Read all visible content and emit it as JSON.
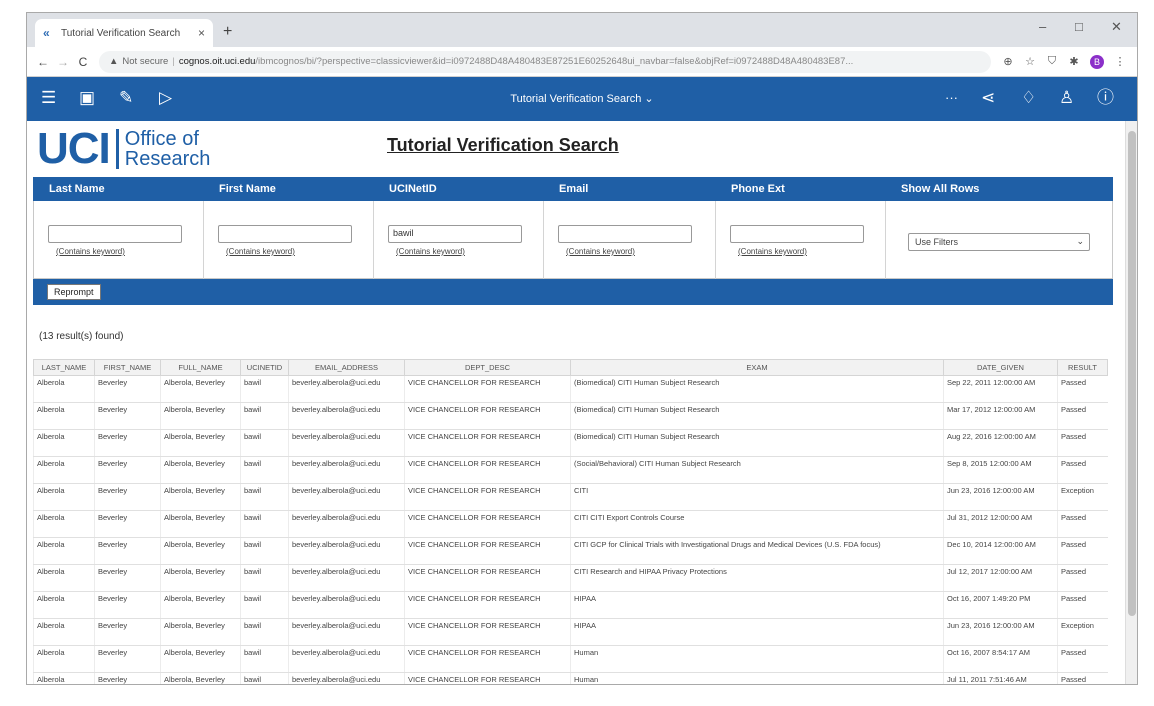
{
  "browser": {
    "tab_title": "Tutorial Verification Search",
    "tab_close": "×",
    "new_tab": "+",
    "win_minimize": "–",
    "win_restore": "□",
    "win_close": "✕",
    "not_secure": "Not secure",
    "url_host": "cognos.oit.uci.edu",
    "url_path": "/ibmcognos/bi/?perspective=classicviewer&id=i0972488D48A480483E87251E60252648ui_navbar=false&objRef=i0972488D48A480483E87..."
  },
  "toolbar": {
    "report_title": "Tutorial Verification Search ⌄",
    "more": "···"
  },
  "logo": {
    "uci": "UCI",
    "line1": "Office of",
    "line2": "Research"
  },
  "page_title": "Tutorial Verification Search",
  "filters": {
    "headers": [
      "Last Name",
      "First Name",
      "UCINetID",
      "Email",
      "Phone Ext",
      "Show All Rows"
    ],
    "hint": "(Contains keyword)",
    "ucinetid_value": "bawil",
    "show_all_value": "Use Filters"
  },
  "reprompt_label": "Reprompt",
  "result_count": "(13 result(s) found)",
  "table": {
    "columns": [
      "LAST_NAME",
      "FIRST_NAME",
      "FULL_NAME",
      "UCINETID",
      "EMAIL_ADDRESS",
      "DEPT_DESC",
      "EXAM",
      "DATE_GIVEN",
      "RESULT"
    ],
    "rows": [
      [
        "Alberola",
        "Beverley",
        "Alberola, Beverley",
        "bawil",
        "beverley.alberola@uci.edu",
        "VICE CHANCELLOR FOR RESEARCH",
        "(Biomedical) CITI Human Subject Research",
        "Sep 22, 2011 12:00:00 AM",
        "Passed"
      ],
      [
        "Alberola",
        "Beverley",
        "Alberola, Beverley",
        "bawil",
        "beverley.alberola@uci.edu",
        "VICE CHANCELLOR FOR RESEARCH",
        "(Biomedical) CITI Human Subject Research",
        "Mar 17, 2012 12:00:00 AM",
        "Passed"
      ],
      [
        "Alberola",
        "Beverley",
        "Alberola, Beverley",
        "bawil",
        "beverley.alberola@uci.edu",
        "VICE CHANCELLOR FOR RESEARCH",
        "(Biomedical) CITI Human Subject Research",
        "Aug 22, 2016 12:00:00 AM",
        "Passed"
      ],
      [
        "Alberola",
        "Beverley",
        "Alberola, Beverley",
        "bawil",
        "beverley.alberola@uci.edu",
        "VICE CHANCELLOR FOR RESEARCH",
        "(Social/Behavioral) CITI Human Subject Research",
        "Sep 8, 2015 12:00:00 AM",
        "Passed"
      ],
      [
        "Alberola",
        "Beverley",
        "Alberola, Beverley",
        "bawil",
        "beverley.alberola@uci.edu",
        "VICE CHANCELLOR FOR RESEARCH",
        "CITI",
        "Jun 23, 2016 12:00:00 AM",
        "Exception"
      ],
      [
        "Alberola",
        "Beverley",
        "Alberola, Beverley",
        "bawil",
        "beverley.alberola@uci.edu",
        "VICE CHANCELLOR FOR RESEARCH",
        "CITI CITI Export Controls Course",
        "Jul 31, 2012 12:00:00 AM",
        "Passed"
      ],
      [
        "Alberola",
        "Beverley",
        "Alberola, Beverley",
        "bawil",
        "beverley.alberola@uci.edu",
        "VICE CHANCELLOR FOR RESEARCH",
        "CITI GCP for Clinical Trials with Investigational Drugs and Medical Devices (U.S. FDA focus)",
        "Dec 10, 2014 12:00:00 AM",
        "Passed"
      ],
      [
        "Alberola",
        "Beverley",
        "Alberola, Beverley",
        "bawil",
        "beverley.alberola@uci.edu",
        "VICE CHANCELLOR FOR RESEARCH",
        "CITI Research and HIPAA Privacy Protections",
        "Jul 12, 2017 12:00:00 AM",
        "Passed"
      ],
      [
        "Alberola",
        "Beverley",
        "Alberola, Beverley",
        "bawil",
        "beverley.alberola@uci.edu",
        "VICE CHANCELLOR FOR RESEARCH",
        "HIPAA",
        "Oct 16, 2007 1:49:20 PM",
        "Passed"
      ],
      [
        "Alberola",
        "Beverley",
        "Alberola, Beverley",
        "bawil",
        "beverley.alberola@uci.edu",
        "VICE CHANCELLOR FOR RESEARCH",
        "HIPAA",
        "Jun 23, 2016 12:00:00 AM",
        "Exception"
      ],
      [
        "Alberola",
        "Beverley",
        "Alberola, Beverley",
        "bawil",
        "beverley.alberola@uci.edu",
        "VICE CHANCELLOR FOR RESEARCH",
        "Human",
        "Oct 16, 2007 8:54:17 AM",
        "Passed"
      ],
      [
        "Alberola",
        "Beverley",
        "Alberola, Beverley",
        "bawil",
        "beverley.alberola@uci.edu",
        "VICE CHANCELLOR FOR RESEARCH",
        "Human",
        "Jul 11, 2011 7:51:46 AM",
        "Passed"
      ]
    ]
  }
}
